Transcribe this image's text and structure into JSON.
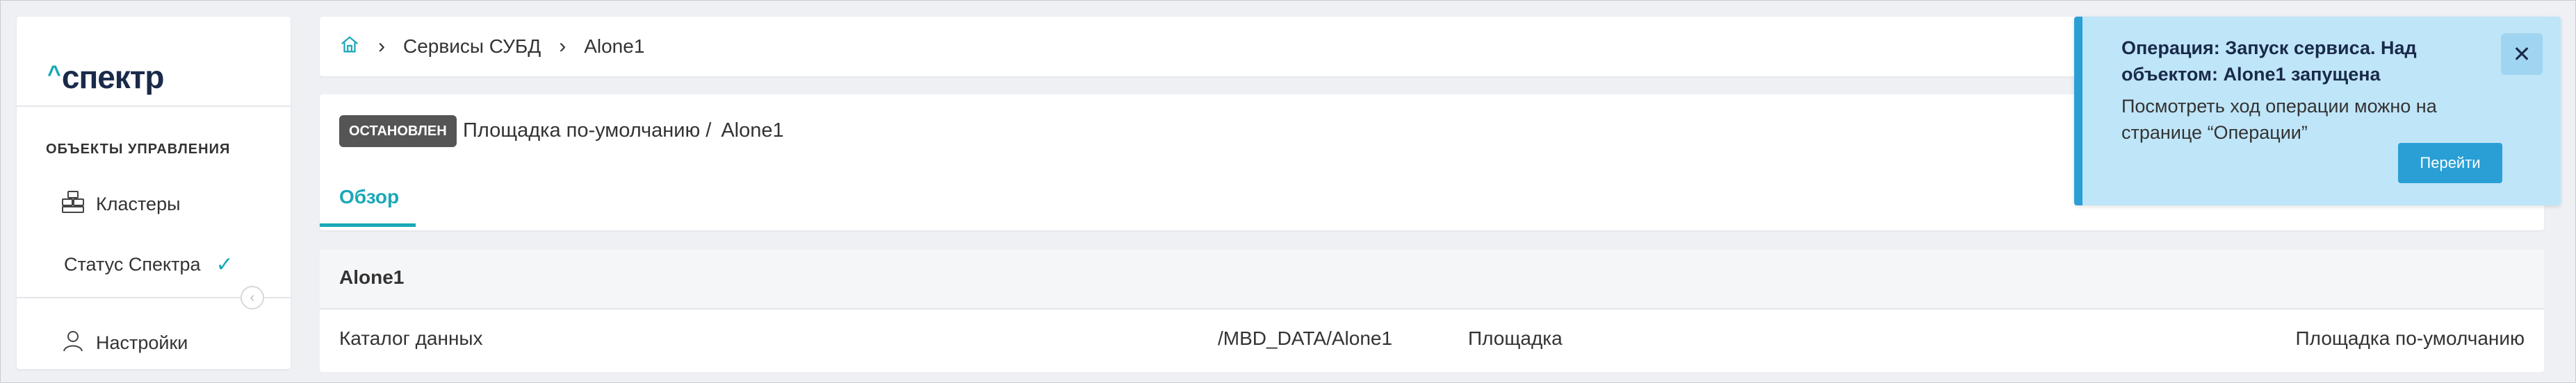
{
  "app": {
    "logo_text": "спектр",
    "logo_caret": "^"
  },
  "sidebar": {
    "section_title": "ОБЪЕКТЫ УПРАВЛЕНИЯ",
    "items": [
      {
        "label": "Кластеры",
        "icon": "clusters-icon"
      },
      {
        "label": "Статус Спектра",
        "icon": "check-icon"
      },
      {
        "label": "Настройки",
        "icon": "user-icon"
      }
    ],
    "collapse_icon": "chevron-left-icon"
  },
  "breadcrumb": {
    "home_icon": "home-icon",
    "items": [
      "Сервисы СУБД",
      "Alone1"
    ]
  },
  "header": {
    "status": "ОСТАНОВЛЕН",
    "site": "Площадка по-умолчанию /",
    "name": "Alone1"
  },
  "tabs": [
    {
      "label": "Обзор",
      "active": true
    }
  ],
  "details": {
    "title": "Alone1",
    "rows": [
      {
        "label": "Каталог данных",
        "value": "/MBD_DATA/Alone1",
        "label2": "Площадка",
        "value2": "Площадка по-умолчанию"
      }
    ]
  },
  "toast": {
    "title": "Операция: Запуск сервиса. Над объектом: Alone1 запущена",
    "body": "Посмотреть ход операции можно на странице “Операции”",
    "button": "Перейти",
    "close_icon": "close-icon"
  },
  "colors": {
    "accent": "#1aa8b8",
    "toast_bg": "#bfe5f8",
    "toast_accent": "#2a9fd6",
    "badge_bg": "#555555"
  }
}
